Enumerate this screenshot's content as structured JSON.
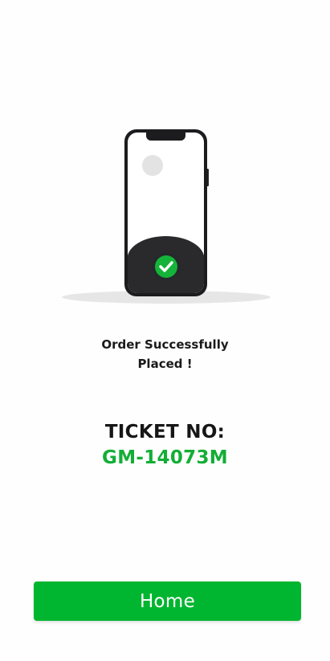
{
  "colors": {
    "background": "#fdfefd",
    "accent_green": "#00b52f",
    "ticket_green": "#13ae36",
    "text_dark": "#161616",
    "phone_body": "#2a2a2d"
  },
  "illustration": {
    "icons": [
      "phone-icon",
      "checkmark-icon"
    ]
  },
  "message": {
    "line1": "Order Successfully",
    "line2": "Placed !"
  },
  "ticket": {
    "label": "TICKET NO:",
    "number": "GM-14073M"
  },
  "home_button": {
    "label": "Home"
  }
}
